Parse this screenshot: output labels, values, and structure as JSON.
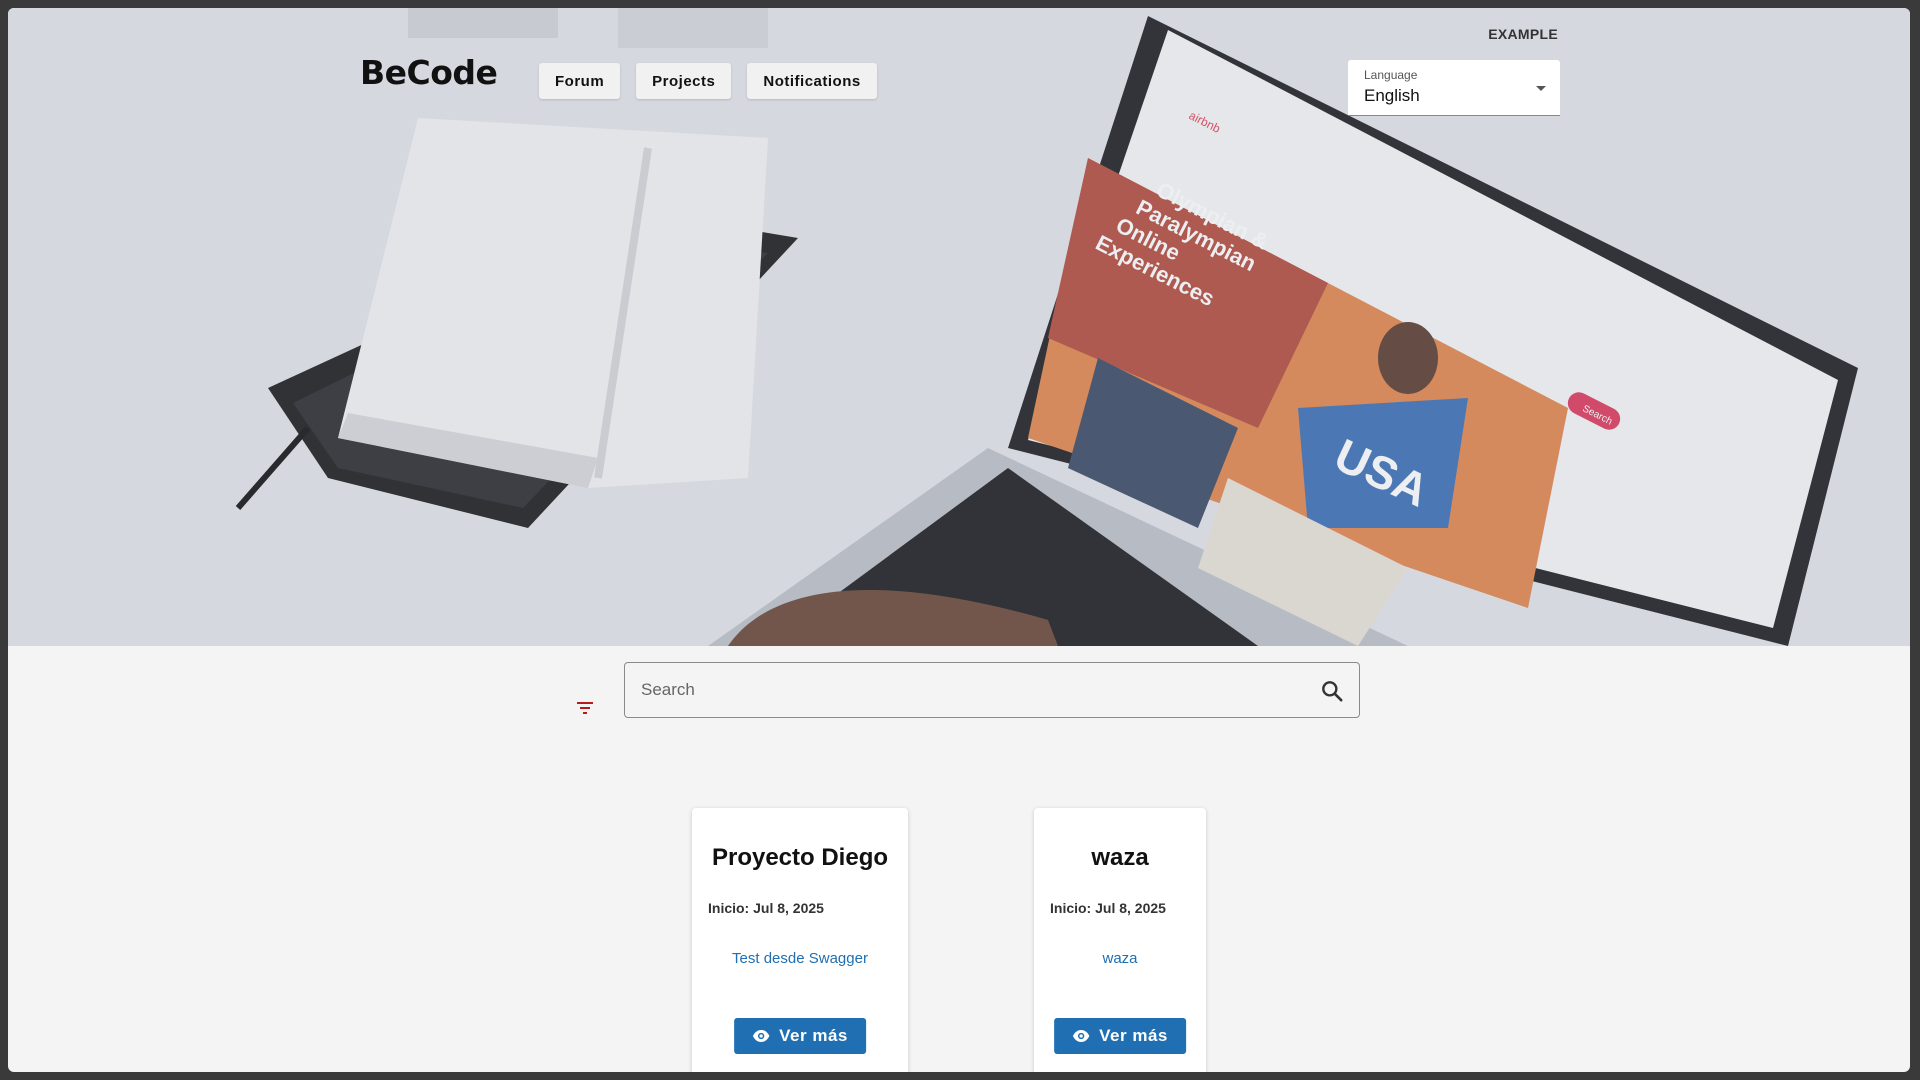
{
  "header": {
    "tag": "EXAMPLE",
    "brand": "BeCode",
    "nav": [
      {
        "label": "Forum"
      },
      {
        "label": "Projects"
      },
      {
        "label": "Notifications"
      }
    ],
    "language": {
      "label": "Language",
      "value": "English"
    }
  },
  "hero_screen": {
    "brand": "airbnb",
    "headline": [
      "Olympian &",
      "Paralympian",
      "Online",
      "Experiences"
    ],
    "search_button": "Search",
    "jersey": "USA"
  },
  "search": {
    "placeholder": "Search",
    "value": ""
  },
  "projects": [
    {
      "title": "Proyecto Diego",
      "date": "Inicio: Jul 8, 2025",
      "description": "Test desde Swagger",
      "button": "Ver más"
    },
    {
      "title": "waza",
      "date": "Inicio: Jul 8, 2025",
      "description": "waza",
      "button": "Ver más"
    }
  ],
  "colors": {
    "accent": "#1f6fb2",
    "filter_icon": "#b71c1c",
    "page_bg": "#f4f4f4"
  }
}
